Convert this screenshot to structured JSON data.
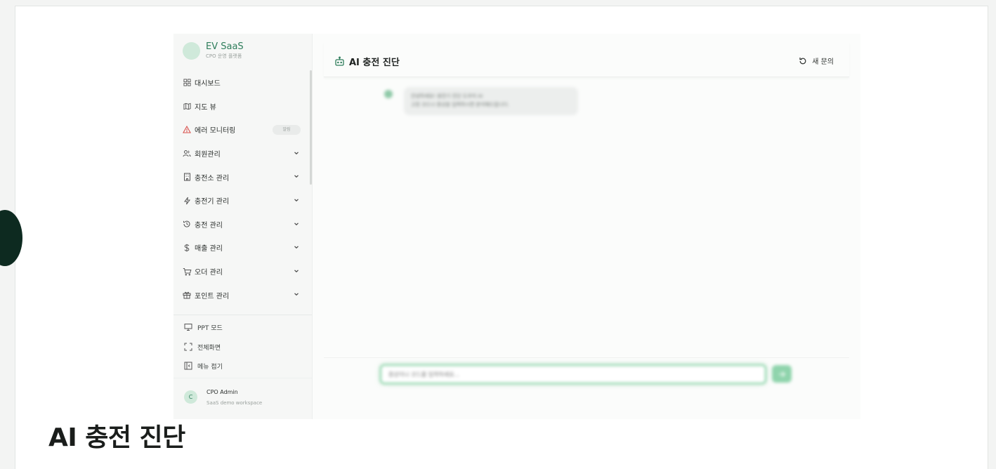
{
  "brand": {
    "title": "EV SaaS",
    "subtitle": "CPO 운영 플랫폼"
  },
  "nav": [
    {
      "label": "대시보드",
      "icon": "dashboard-icon",
      "expandable": false
    },
    {
      "label": "지도 뷰",
      "icon": "map-icon",
      "expandable": false
    },
    {
      "label": "에러 모니터링",
      "icon": "warning-icon",
      "badge": "알림",
      "expandable": false
    },
    {
      "label": "회원관리",
      "icon": "users-icon",
      "expandable": true
    },
    {
      "label": "충전소 관리",
      "icon": "building-icon",
      "expandable": true
    },
    {
      "label": "충전기 관리",
      "icon": "bolt-icon",
      "expandable": true
    },
    {
      "label": "충전 관리",
      "icon": "history-icon",
      "expandable": true
    },
    {
      "label": "매출 관리",
      "icon": "dollar-icon",
      "expandable": true
    },
    {
      "label": "오더 관리",
      "icon": "cart-icon",
      "expandable": true
    },
    {
      "label": "포인트 관리",
      "icon": "gift-icon",
      "expandable": true
    }
  ],
  "tools": [
    {
      "label": "PPT 모드",
      "icon": "presentation-icon"
    },
    {
      "label": "전체화면",
      "icon": "fullscreen-icon"
    },
    {
      "label": "메뉴 접기",
      "icon": "sidebar-collapse-icon"
    }
  ],
  "user": {
    "avatar": "C",
    "name": "CPO Admin",
    "workspace": "SaaS demo workspace"
  },
  "chat": {
    "title": "AI 충전 진단",
    "new_question": "새 문의",
    "message_lines": [
      "안녕하세요! 충전기 진단 도우미 AI",
      "고장 코드나 증상을 입력하시면 분석해드립니다."
    ],
    "input_placeholder": "증상이나 코드를 입력하세요..."
  },
  "page_heading": "AI 충전 진단",
  "colors": {
    "accent": "#2e7d5b",
    "accent_light": "#cfe9da",
    "warning": "#d9534f"
  }
}
